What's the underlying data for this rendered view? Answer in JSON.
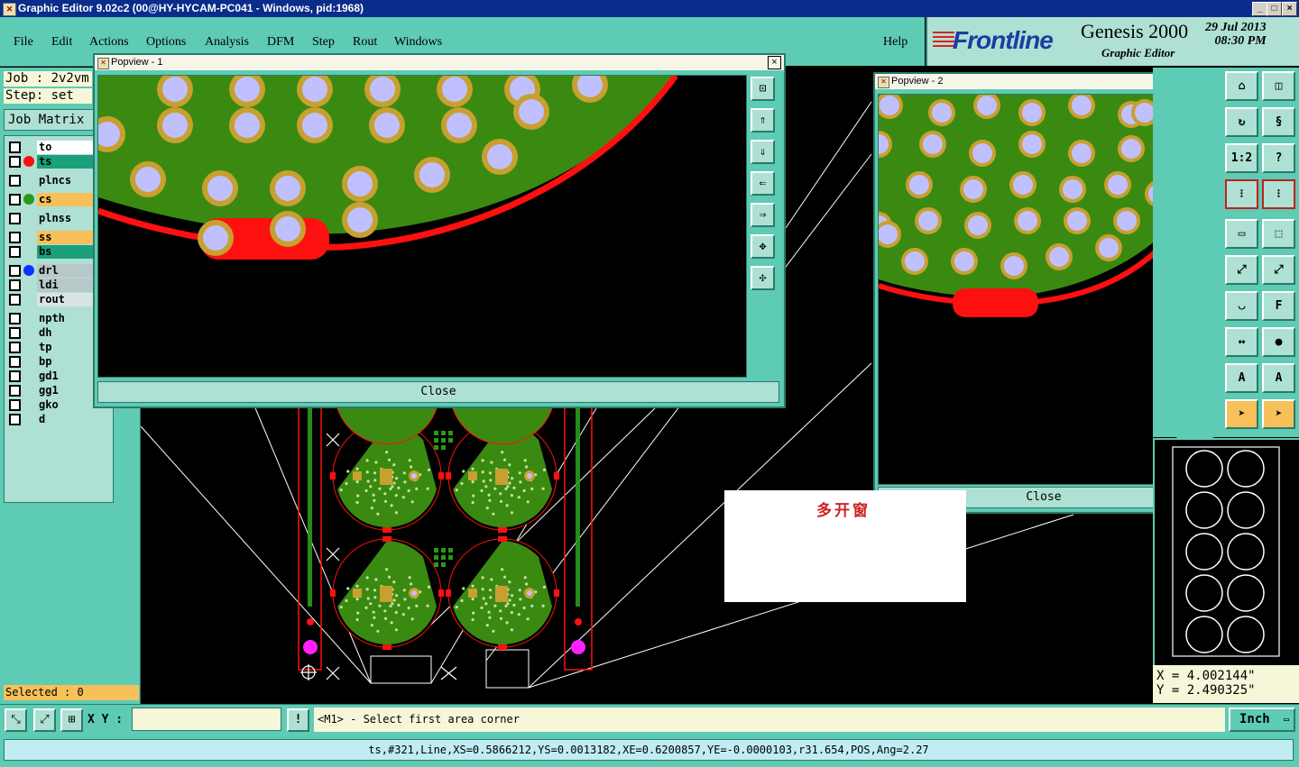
{
  "window": {
    "title": "Graphic Editor 9.02c2 (00@HY-HYCAM-PC041 - Windows, pid:1968)",
    "controls": [
      "_",
      "□",
      "×"
    ]
  },
  "menu": {
    "items": [
      "File",
      "Edit",
      "Actions",
      "Options",
      "Analysis",
      "DFM",
      "Step",
      "Rout",
      "Windows"
    ],
    "help": "Help"
  },
  "brand": {
    "logo": "Frontline",
    "product": "Genesis 2000",
    "subtitle": "Graphic Editor",
    "date": "29 Jul 2013",
    "time": "08:30 PM"
  },
  "left_panel": {
    "job": "Job : 2v2vm",
    "step": "Step: set",
    "job_matrix": "Job Matrix",
    "layers": [
      {
        "name": "to",
        "bg": "#ffffff",
        "dot": ""
      },
      {
        "name": "ts",
        "bg": "#1aa07a",
        "dot": "#ff1010"
      },
      {
        "name": "plncs",
        "bg": "#aee0d4",
        "dot": ""
      },
      {
        "name": "cs",
        "bg": "#f8c058",
        "dot": "#2a9a1a"
      },
      {
        "name": "plnss",
        "bg": "#aee0d4",
        "dot": ""
      },
      {
        "name": "ss",
        "bg": "#f8c058",
        "dot": ""
      },
      {
        "name": "bs",
        "bg": "#1aa07a",
        "dot": ""
      },
      {
        "name": "drl",
        "bg": "#b8c8c8",
        "dot": "#1030ff"
      },
      {
        "name": "ldi",
        "bg": "#b8c8c8",
        "dot": ""
      },
      {
        "name": "rout",
        "bg": "#d8e4e4",
        "dot": ""
      },
      {
        "name": "npth",
        "bg": "#aee0d4",
        "dot": ""
      },
      {
        "name": "dh",
        "bg": "#aee0d4",
        "dot": ""
      },
      {
        "name": "tp",
        "bg": "#aee0d4",
        "dot": ""
      },
      {
        "name": "bp",
        "bg": "#aee0d4",
        "dot": ""
      },
      {
        "name": "gd1",
        "bg": "#aee0d4",
        "dot": ""
      },
      {
        "name": "gg1",
        "bg": "#aee0d4",
        "dot": ""
      },
      {
        "name": "gko",
        "bg": "#aee0d4",
        "dot": ""
      },
      {
        "name": "d",
        "bg": "#aee0d4",
        "dot": ""
      }
    ],
    "selected": "Selected : 0"
  },
  "popview1": {
    "title": "Popview - 1",
    "close": "Close",
    "close_x": "×"
  },
  "popview2": {
    "title": "Popview - 2",
    "close": "Close",
    "close_x": "×"
  },
  "annotation": {
    "text": "多开窗"
  },
  "right_toolbar": {
    "labels": [
      "1:2",
      "?"
    ]
  },
  "coords": {
    "x": "X = 4.002144\"",
    "y": "Y = 2.490325\""
  },
  "bottom": {
    "xy_label": "X Y :",
    "xy_value": "",
    "warn": "!",
    "prompt": "<M1> - Select first area corner",
    "units": "Inch"
  },
  "status": {
    "text": "ts,#321,Line,XS=0.5866212,YS=0.0013182,XE=0.6200857,YE=-0.0000103,r31.654,POS,Ang=2.27"
  },
  "colors": {
    "panel": "#5ecbb4",
    "pcb_green": "#3a8a12",
    "pad_ring": "#c8a030",
    "pad_fill": "#c0c0ff",
    "outline_red": "#ff1010"
  }
}
